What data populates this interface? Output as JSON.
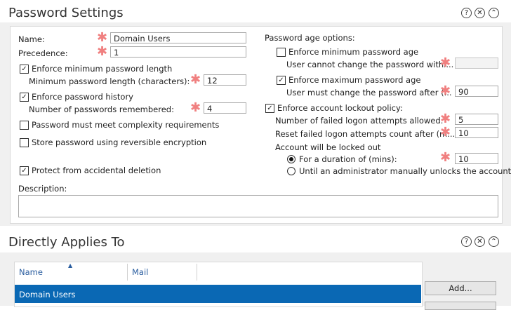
{
  "password_settings": {
    "title": "Password Settings",
    "header_icons": [
      "help-icon",
      "close-icon",
      "collapse-icon"
    ],
    "name_label": "Name:",
    "name_value": "Domain Users",
    "precedence_label": "Precedence:",
    "precedence_value": "1",
    "enforce_min_length": {
      "label": "Enforce minimum password length",
      "checked": true
    },
    "min_length_label": "Minimum password length (characters):",
    "min_length_value": "12",
    "enforce_history": {
      "label": "Enforce password history",
      "checked": true
    },
    "history_label": "Number of passwords remembered:",
    "history_value": "4",
    "complexity": {
      "label": "Password must meet complexity requirements",
      "checked": false
    },
    "reversible": {
      "label": "Store password using reversible encryption",
      "checked": false
    },
    "protect_deletion": {
      "label": "Protect from accidental deletion",
      "checked": true
    },
    "description_label": "Description:",
    "description_value": "",
    "age_options_label": "Password age options:",
    "enforce_min_age": {
      "label": "Enforce minimum password age",
      "checked": false
    },
    "min_age_label": "User cannot change the password withi...",
    "min_age_value": "",
    "enforce_max_age": {
      "label": "Enforce maximum password age",
      "checked": true
    },
    "max_age_label": "User must change the password after (...",
    "max_age_value": "90",
    "lockout_policy": {
      "label": "Enforce account lockout policy:",
      "checked": true
    },
    "failed_attempts_label": "Number of failed logon attempts allowed:",
    "failed_attempts_value": "5",
    "reset_count_label": "Reset failed logon attempts count after (m...",
    "reset_count_value": "10",
    "locked_out_label": "Account will be locked out",
    "duration_option": {
      "label": "For a duration of (mins):",
      "selected": true
    },
    "duration_value": "10",
    "manual_unlock_option": {
      "label": "Until an administrator manually unlocks the account",
      "selected": false
    }
  },
  "applies_to": {
    "title": "Directly Applies To",
    "columns": [
      "Name",
      "Mail"
    ],
    "rows": [
      {
        "name": "Domain Users",
        "mail": "",
        "selected": true
      }
    ],
    "add_button": "Add..."
  },
  "colors": {
    "required": "#f08080",
    "selection": "#0a68b4",
    "column_header": "#2a5d9f"
  }
}
